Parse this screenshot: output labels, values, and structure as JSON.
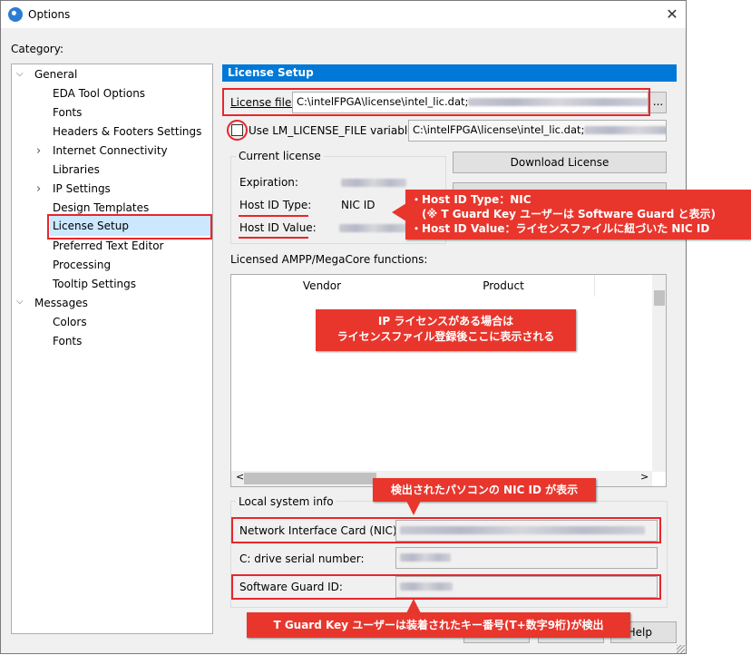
{
  "window": {
    "title": "Options",
    "close_glyph": "✕"
  },
  "category_label": "Category:",
  "tree": [
    {
      "label": "General",
      "arrow": "⌵",
      "expanded": true
    },
    {
      "label": "EDA Tool Options"
    },
    {
      "label": "Fonts"
    },
    {
      "label": "Headers & Footers Settings"
    },
    {
      "label": "Internet Connectivity",
      "arrow": "›"
    },
    {
      "label": "Libraries"
    },
    {
      "label": "IP Settings",
      "arrow": "›"
    },
    {
      "label": "Design Templates"
    },
    {
      "label": "License Setup",
      "selected": true
    },
    {
      "label": "Preferred Text Editor"
    },
    {
      "label": "Processing"
    },
    {
      "label": "Tooltip Settings"
    },
    {
      "label": "Messages",
      "arrow": "⌵",
      "expanded": true
    },
    {
      "label": "Colors"
    },
    {
      "label": "Fonts"
    }
  ],
  "panel": {
    "header": "License Setup",
    "license_file_label": "License file:",
    "license_file_value": "C:\\intelFPGA\\license\\intel_lic.dat;",
    "browse_label": "...",
    "use_lm_label": "Use LM_LICENSE_FILE variable:",
    "lm_value": "C:\\intelFPGA\\license\\intel_lic.dat;",
    "current_license": "Current license",
    "expiration_label": "Expiration:",
    "host_id_type_label": "Host ID Type:",
    "host_id_type_value": "NIC ID",
    "host_id_value_label": "Host ID Value:",
    "download_label": "Download License",
    "ampp_label": "Licensed AMPP/MegaCore functions:",
    "columns": [
      "Vendor",
      "Product"
    ],
    "local_info": "Local system info",
    "nic_label": "Network Interface Card (NIC) ID:",
    "cdrive_label": "C: drive serial number:",
    "guard_label": "Software Guard ID:",
    "help_label": "Help",
    "scroll_left": "<",
    "scroll_right": ">"
  },
  "callouts": {
    "host_id": [
      "・Host ID Type：NIC",
      "　(※ T Guard Key ユーザーは Software Guard と表示)",
      "・Host ID Value：ライセンスファイルに紐づいた NIC ID"
    ],
    "ip_license": [
      "IP ライセンスがある場合は",
      "ライセンスファイル登録後ここに表示される"
    ],
    "nic": "検出されたパソコンの NIC ID が表示",
    "guard": "T Guard Key ユーザーは装着されたキー番号(T+数字9桁)が検出"
  },
  "colors": {
    "accent": "#0078d7",
    "annotation": "#e8262a",
    "selection": "#cce8ff"
  }
}
